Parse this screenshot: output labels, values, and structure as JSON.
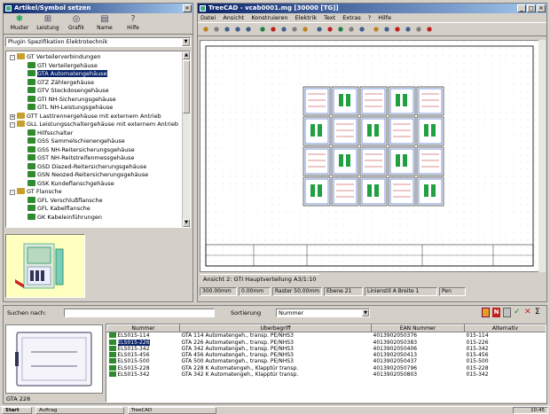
{
  "left_window": {
    "title": "Artikel/Symbol setzen",
    "toolbar": [
      "Muster",
      "Leistung",
      "Grafik",
      "Name",
      "Hilfe"
    ],
    "plugin_select": "Plugin Spezifikation Elektrotechnik",
    "tree": [
      {
        "label": "GT Verteilerverbindungen",
        "level": 0,
        "expand": "-"
      },
      {
        "label": "GTI Verteilergehäuse",
        "level": 1
      },
      {
        "label": "GTA Automatengehäuse",
        "level": 1,
        "selected": true
      },
      {
        "label": "GTZ Zählergehäuse",
        "level": 1
      },
      {
        "label": "GTV Steckdosengehäuse",
        "level": 1
      },
      {
        "label": "GTI NH-Sicherungsgehäuse",
        "level": 1
      },
      {
        "label": "GTL NH-Leistungsgehäuse",
        "level": 1
      },
      {
        "label": "GTT Lasttrennergehäuse mit externem Antrieb",
        "level": 0,
        "expand": "+"
      },
      {
        "label": "GLL Leistungsschaltergehäuse mit externem Antrieb",
        "level": 0,
        "expand": "-"
      },
      {
        "label": "Hilfsschalter",
        "level": 1
      },
      {
        "label": "GSS Sammelschienengehäuse",
        "level": 1
      },
      {
        "label": "GSS NH-Reitersicherungsgehäuse",
        "level": 1
      },
      {
        "label": "GST NH-Reitstreifenmessgehäuse",
        "level": 1
      },
      {
        "label": "GSD Diazed-Reitersicherungsgehäuse",
        "level": 1
      },
      {
        "label": "GSN Neozed-Reitersicherungsgehäuse",
        "level": 1
      },
      {
        "label": "GSK Kundeflanschgehäuse",
        "level": 1
      },
      {
        "label": "GT Flansche",
        "level": 0,
        "expand": "-"
      },
      {
        "label": "GFL Verschlußflansche",
        "level": 1
      },
      {
        "label": "GFL Kabelflansche",
        "level": 1
      },
      {
        "label": "GK Kabeleinführungen",
        "level": 1
      }
    ]
  },
  "cad_window": {
    "title": "TreeCAD - vcab0001.mg [30000 [TG]]",
    "menu": [
      "Datei",
      "Ansicht",
      "Konstruieren",
      "Elektrik",
      "Text",
      "Extras",
      "?",
      "Hilfe"
    ],
    "tab_text": "Ansicht 2: GTI Hauptverteilung A3/1:10",
    "status": [
      "300.00mm",
      "0.00mm",
      "Raster 50.00mm",
      "Ebene 21",
      "Linienstil A Breite 1",
      "Pen"
    ]
  },
  "bottom_panel": {
    "search_label": "Suchen nach:",
    "search_value": "",
    "sort_label": "Sortierung",
    "sort_value": "Nummer",
    "preview_caption": "GTA 228",
    "table": {
      "headers": [
        "Nummer",
        "Überbegriff",
        "EAN Nummer",
        "Alternativ"
      ],
      "rows": [
        [
          "ELS015-114",
          "GTA 114 Automatengeh., transp. PE/NHS3",
          "4013902050376",
          "015-114"
        ],
        [
          "ELS015-226",
          "GTA 226 Automatengeh., transp. PE/NHS3",
          "4013902050383",
          "015-226"
        ],
        [
          "ELS015-342",
          "GTA 342 Automatengeh., transp. PE/NHS3",
          "4013902050406",
          "015-342"
        ],
        [
          "ELS015-456",
          "GTA 456 Automatengeh., transp. PE/NHS3",
          "4013902050413",
          "015-456"
        ],
        [
          "ELS015-500",
          "GTA 500 Automatengeh., transp. PE/NHS3",
          "4013902050437",
          "015-500"
        ],
        [
          "ELS015-228",
          "GTA 228 K Automatengeh., Klapptür transp.",
          "4013902050796",
          "015-228"
        ],
        [
          "ELS015-342",
          "GTA 342 K Automatengeh., Klapptür transp.",
          "4013902050803",
          "015-342"
        ]
      ],
      "selected_row": 1
    }
  },
  "taskbar": {
    "items": [
      "Start",
      "Auftrag",
      "TreeCAD"
    ],
    "clock": "10:45"
  }
}
